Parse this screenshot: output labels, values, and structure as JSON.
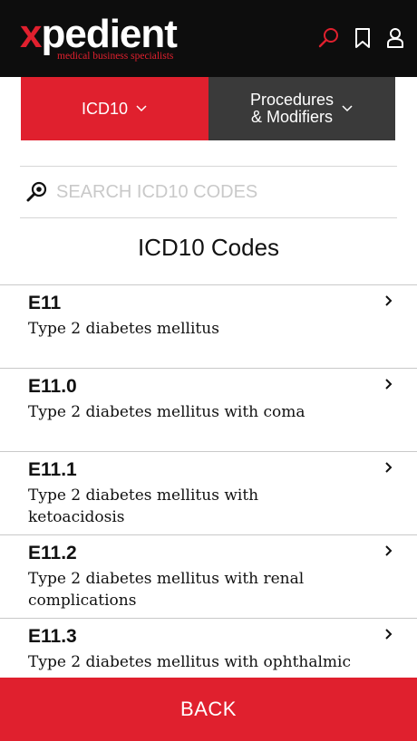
{
  "header": {
    "logo_x": "x",
    "logo_word": "pedient",
    "logo_tagline": "medical business specialists",
    "icons": [
      "search-icon",
      "bookmark-icon",
      "user-icon"
    ],
    "accent_color": "#e0202e",
    "background_color": "#0d0d0d"
  },
  "tabs": [
    {
      "label": "ICD10",
      "active": true
    },
    {
      "label_line1": "Procedures",
      "label_line2": "& Modifiers",
      "active": false
    }
  ],
  "search": {
    "placeholder": "SEARCH ICD10 CODES",
    "value": ""
  },
  "title": "ICD10 Codes",
  "codes": [
    {
      "code": "E11",
      "description": "Type 2 diabetes mellitus"
    },
    {
      "code": "E11.0",
      "description": "Type 2 diabetes mellitus with coma"
    },
    {
      "code": "E11.1",
      "description": "Type 2 diabetes mellitus with ketoacidosis"
    },
    {
      "code": "E11.2",
      "description": "Type 2 diabetes mellitus with renal complications"
    },
    {
      "code": "E11.3",
      "description": "Type 2 diabetes mellitus with ophthalmic"
    }
  ],
  "back_label": "BACK"
}
